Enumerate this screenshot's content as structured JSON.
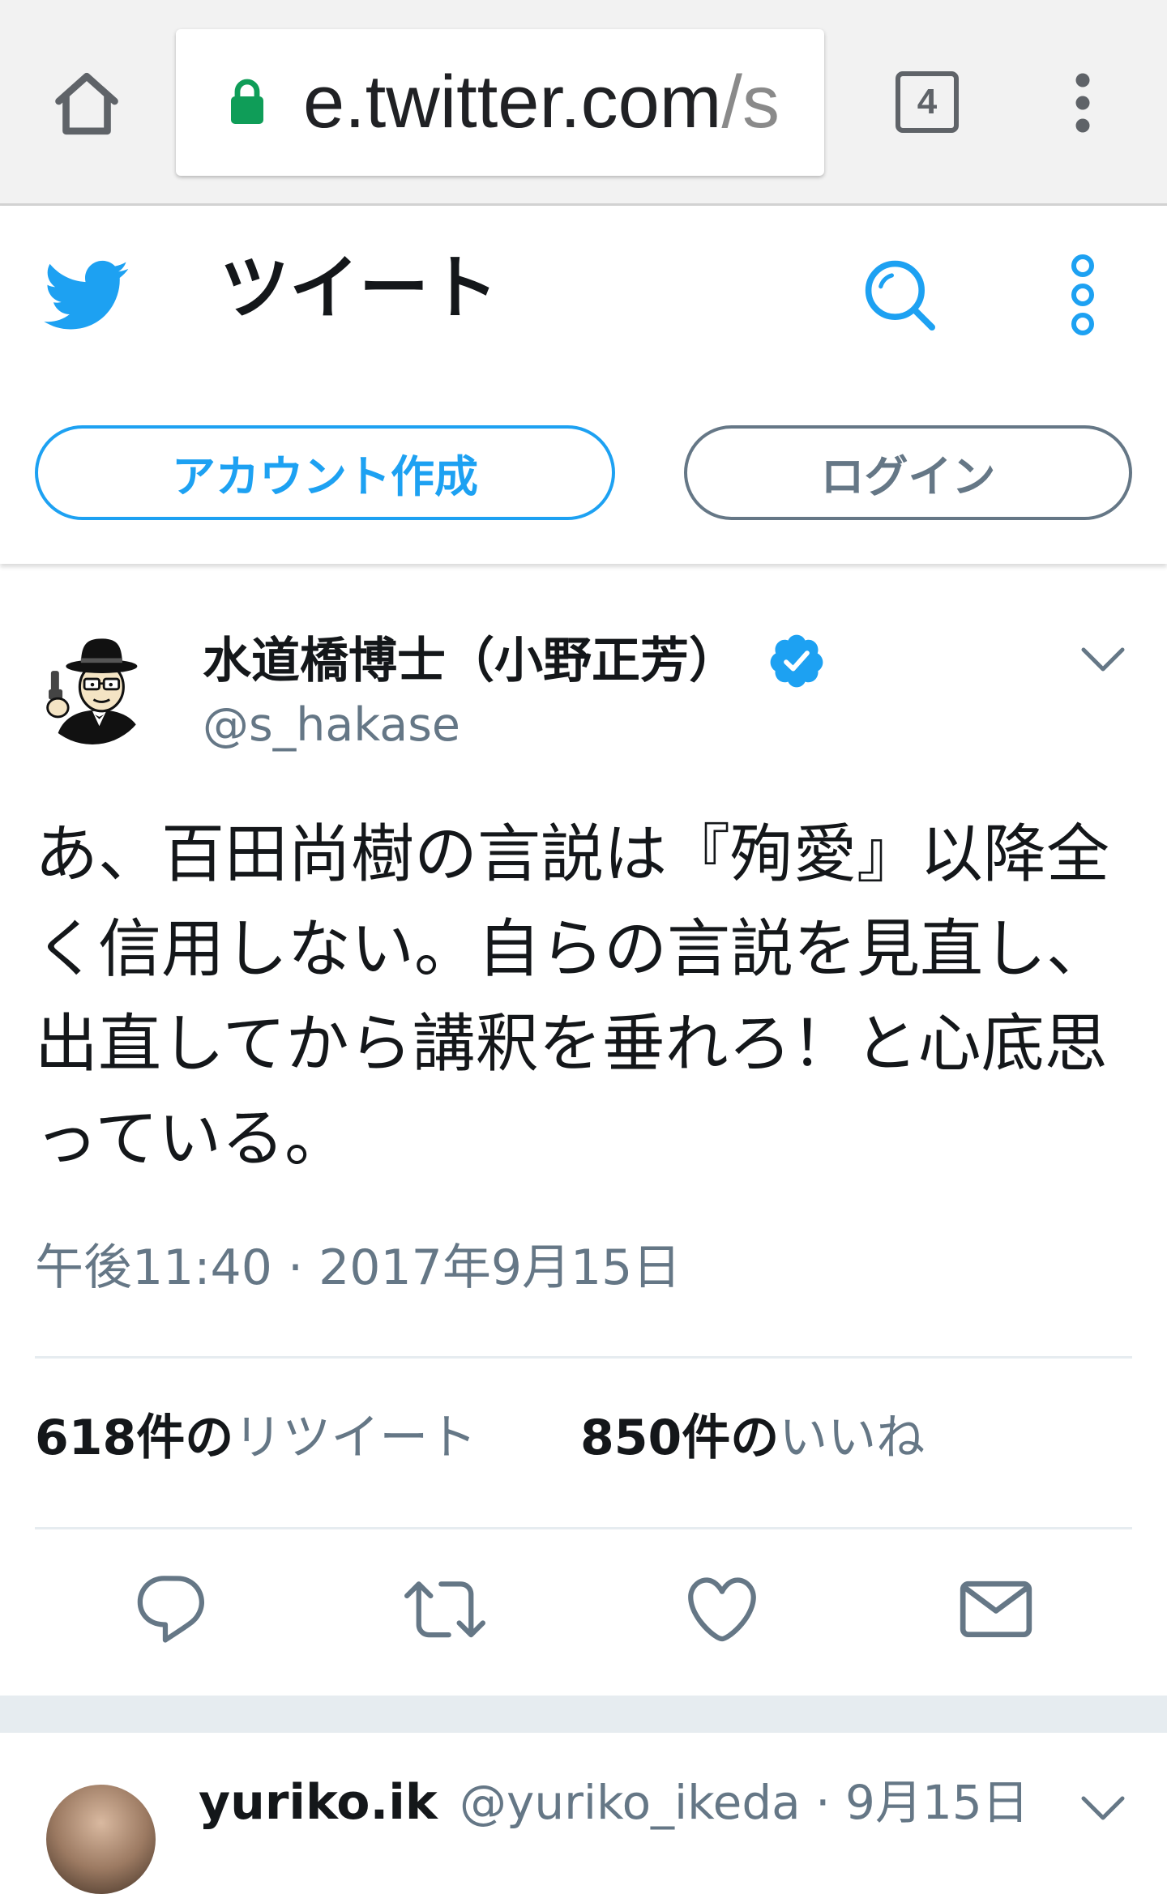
{
  "browser": {
    "url_domain": "e.twitter.com",
    "url_path": "/s",
    "tab_count": "4",
    "icons": {
      "home": "home-icon",
      "lock": "lock-icon",
      "tabs": "tab-switcher-icon",
      "menu": "more-vert-icon"
    }
  },
  "header": {
    "title": "ツイート",
    "icons": {
      "logo": "twitter-bird-icon",
      "search": "search-icon",
      "menu": "more-vert-outline-icon"
    }
  },
  "auth": {
    "signup_label": "アカウント作成",
    "login_label": "ログイン"
  },
  "tweet": {
    "author_name": "水道橋博士（小野正芳）",
    "handle": "@s_hakase",
    "verified": true,
    "text": "あ、百田尚樹の言説は『殉愛』以降全く信用しない。自らの言説を見直し、出直してから講釈を垂れろ！と心底思っている。",
    "timestamp": "午後11:40 · 2017年9月15日",
    "stats": {
      "retweets_count": "618件の",
      "retweets_label": "リツイート",
      "likes_count": "850件の",
      "likes_label": "いいね"
    },
    "actions": [
      "reply-icon",
      "retweet-icon",
      "like-icon",
      "message-icon"
    ]
  },
  "next_tweet": {
    "author_name": "yuriko.ik",
    "meta": "@yuriko_ikeda · 9月15日"
  },
  "colors": {
    "accent": "#1da1f2",
    "text_primary": "#14171a",
    "text_secondary": "#657786",
    "divider": "#e6ecf0",
    "lock_green": "#0f9d58",
    "browser_bar": "#f2f2f2"
  }
}
